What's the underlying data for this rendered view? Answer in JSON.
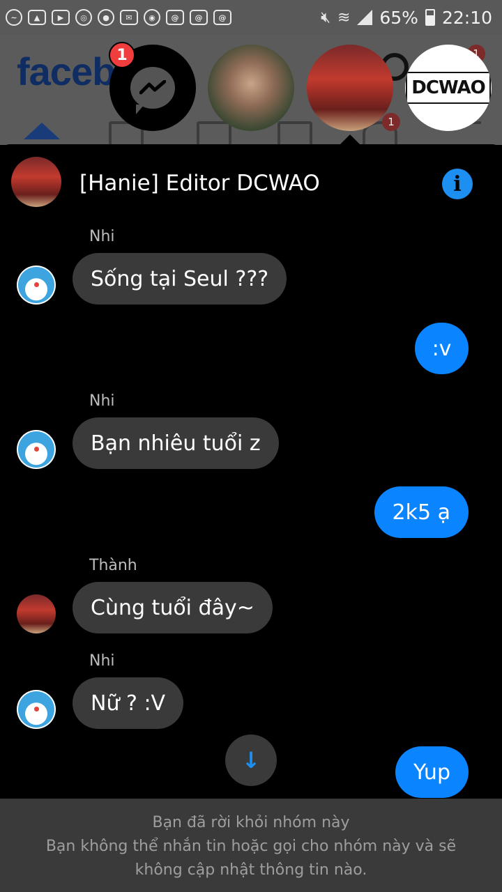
{
  "status_bar": {
    "battery": "65%",
    "time": "22:10"
  },
  "background_app": {
    "logo": "faceb",
    "notification_badge": "1",
    "tab_badges": [
      "1"
    ]
  },
  "chat_heads": {
    "unread_count": "1",
    "dcwao_logo": "DCWAO"
  },
  "chat": {
    "title": "[Hanie] Editor DCWAO",
    "info_label": "i",
    "messages": [
      {
        "sender": "Nhi",
        "text": "Sống tại Seul ???",
        "direction": "in"
      },
      {
        "sender": "",
        "text": ":v",
        "direction": "out"
      },
      {
        "sender": "Nhi",
        "text": "Bạn nhiêu tuổi z",
        "direction": "in"
      },
      {
        "sender": "",
        "text": "2k5 ạ",
        "direction": "out"
      },
      {
        "sender": "Thành",
        "text": "Cùng tuổi đây~",
        "direction": "in"
      },
      {
        "sender": "Nhi",
        "text": "Nữ ? :V",
        "direction": "in"
      },
      {
        "sender": "",
        "text": "Yup",
        "direction": "out"
      }
    ],
    "scroll_down_icon": "↓"
  },
  "footer": {
    "line1": "Bạn đã rời khỏi nhóm này",
    "line2": "Bạn không thể nhắn tin hoặc gọi cho nhóm này và sẽ",
    "line3": "không cập nhật thông tin nào."
  },
  "colors": {
    "accent": "#0b84ff",
    "incoming_bubble": "#3a3a3a",
    "badge": "#f03e3e"
  }
}
